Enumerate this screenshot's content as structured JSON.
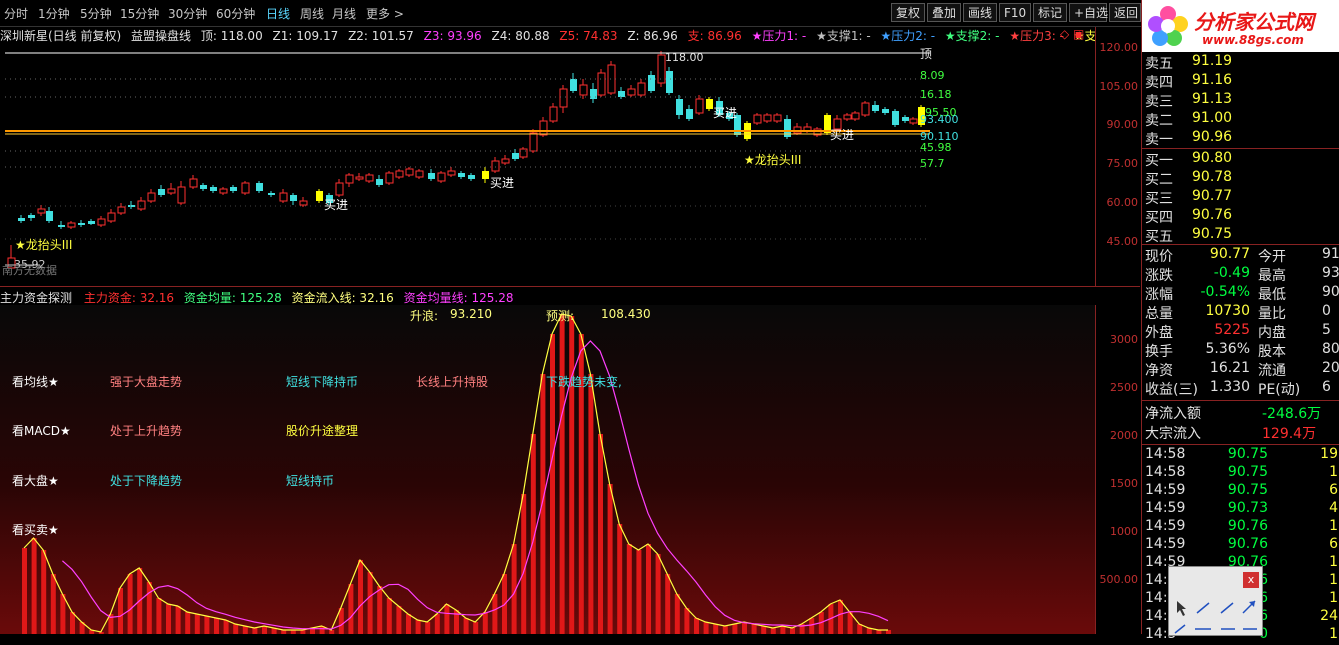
{
  "toolbar": {
    "timeframes": [
      "分时",
      "1分钟",
      "5分钟",
      "15分钟",
      "30分钟",
      "60分钟",
      "日线",
      "周线",
      "月线",
      "更多 >"
    ],
    "active_timeframe": "日线",
    "buttons": [
      "复权",
      "叠加",
      "画线",
      "F10",
      "标记",
      "+自选",
      "返回"
    ]
  },
  "info_line": {
    "stock": "深圳新星(日线 前复权)",
    "indicator": "益盟操盘线",
    "top_label": "顶: 118.00",
    "z1": "Z1: 109.17",
    "z2": "Z2: 101.57",
    "z3": "Z3: 93.96",
    "z4": "Z4: 80.88",
    "z5": "Z5: 74.83",
    "z": "Z: 86.96",
    "zhi": "支: 86.96",
    "legend": [
      "★压力1: -",
      "★支撑1: -",
      "★压力2: -",
      "★支撑2: -",
      "★压力3: -",
      "★支撑3: -"
    ],
    "legend_colors": [
      "#ff40ff",
      "#c0c0c0",
      "#40a0ff",
      "#40ff80",
      "#ff4040",
      "#ffff40"
    ],
    "corner_icons": "◇ ▣"
  },
  "main_chart": {
    "peak_label": "118.00",
    "top_tag": "顶",
    "right_levels": [
      "8.09",
      "16.18",
      "95.50",
      "93.400",
      "90.110",
      "45.98",
      "57.7"
    ],
    "signals": [
      {
        "text": "★龙抬头III",
        "color": "#ffff40"
      },
      {
        "text": "买进",
        "color": "#ffffff"
      },
      {
        "text": "买进",
        "color": "#ffffff"
      },
      {
        "text": "买进",
        "color": "#ffffff"
      },
      {
        "text": "★龙抬头III",
        "color": "#ffff40"
      },
      {
        "text": "买进",
        "color": "#ffffff"
      }
    ],
    "low_label": "35.92",
    "no_data": "南方无数据"
  },
  "price_axis": [
    "120.00",
    "105.00",
    "90.00",
    "75.00",
    "60.00",
    "45.00"
  ],
  "indicator": {
    "name": "主力资金探测",
    "zhuli": "主力资金: 32.16",
    "junliang": "资金均量: 125.28",
    "liuru": "资金流入线: 32.16",
    "junliangxian": "资金均量线: 125.28",
    "shenglang": "升浪:",
    "shenglang_val": "93.210",
    "yuce": "预测:",
    "yuce_val": "108.430",
    "messages": {
      "row1": [
        "看均线★",
        "强于大盘走势",
        "短线下降持币",
        "长线上升持股",
        "下跌趋势未变,"
      ],
      "row2": [
        "看MACD★",
        "处于上升趋势",
        "股价升途整理"
      ],
      "row3": [
        "看大盘★",
        "处于下降趋势",
        "短线持币"
      ],
      "row4": [
        "看买卖★"
      ]
    },
    "axis": [
      "3000",
      "2500",
      "2000",
      "1500",
      "1000",
      "500.00"
    ]
  },
  "logo": {
    "title": "分析家公式网",
    "url": "www.88gs.com"
  },
  "order_book": {
    "asks": [
      [
        "卖五",
        "91.19"
      ],
      [
        "卖四",
        "91.16"
      ],
      [
        "卖三",
        "91.13"
      ],
      [
        "卖二",
        "91.00"
      ],
      [
        "卖一",
        "90.96"
      ]
    ],
    "bids": [
      [
        "买一",
        "90.80"
      ],
      [
        "买二",
        "90.78"
      ],
      [
        "买三",
        "90.77"
      ],
      [
        "买四",
        "90.76"
      ],
      [
        "买五",
        "90.75"
      ]
    ]
  },
  "quote": [
    [
      "现价",
      "90.77",
      "今开",
      "91"
    ],
    [
      "涨跌",
      "-0.49",
      "最高",
      "93"
    ],
    [
      "涨幅",
      "-0.54%",
      "最低",
      "90"
    ],
    [
      "总量",
      "10730",
      "量比",
      "0"
    ],
    [
      "外盘",
      "5225",
      "内盘",
      "5"
    ],
    [
      "换手",
      "5.36%",
      "股本",
      "800"
    ],
    [
      "净资",
      "16.21",
      "流通",
      "200"
    ],
    [
      "收益(三)",
      "1.330",
      "PE(动)",
      "6"
    ]
  ],
  "flow": [
    [
      "净流入额",
      "-248.6万"
    ],
    [
      "大宗流入",
      "129.4万"
    ]
  ],
  "ticks": [
    [
      "14:58",
      "90.75",
      "19"
    ],
    [
      "14:58",
      "90.75",
      "1"
    ],
    [
      "14:59",
      "90.75",
      "6"
    ],
    [
      "14:59",
      "90.73",
      "4"
    ],
    [
      "14:59",
      "90.76",
      "1"
    ],
    [
      "14:59",
      "90.76",
      "6"
    ],
    [
      "14:59",
      "90.76",
      "1"
    ],
    [
      "14:59",
      "6",
      "1"
    ],
    [
      "14:5",
      "6",
      "1"
    ],
    [
      "14:5",
      "6",
      "24"
    ],
    [
      "14:5",
      "0",
      "1"
    ]
  ],
  "colors": {
    "up": "#ff3030",
    "down": "#40e0e0",
    "bg": "#000000",
    "border": "#882222",
    "yellow": "#ffff00",
    "green": "#00ff00"
  }
}
